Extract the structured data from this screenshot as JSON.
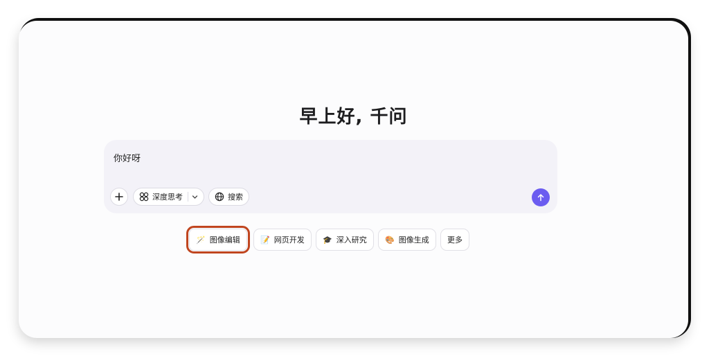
{
  "greeting": "早上好, 千问",
  "composer": {
    "input_value": "你好呀",
    "deep_think_label": "深度思考",
    "search_label": "搜索"
  },
  "shortcuts": [
    {
      "label": "图像编辑",
      "emoji": "🪄",
      "selected": true
    },
    {
      "label": "网页开发",
      "emoji": "📝"
    },
    {
      "label": "深入研究",
      "emoji": "🎓"
    },
    {
      "label": "图像生成",
      "emoji": "🎨"
    },
    {
      "label": "更多",
      "emoji": ""
    }
  ],
  "colors": {
    "accent": "#6b5cf0",
    "highlight": "#c0451f"
  }
}
